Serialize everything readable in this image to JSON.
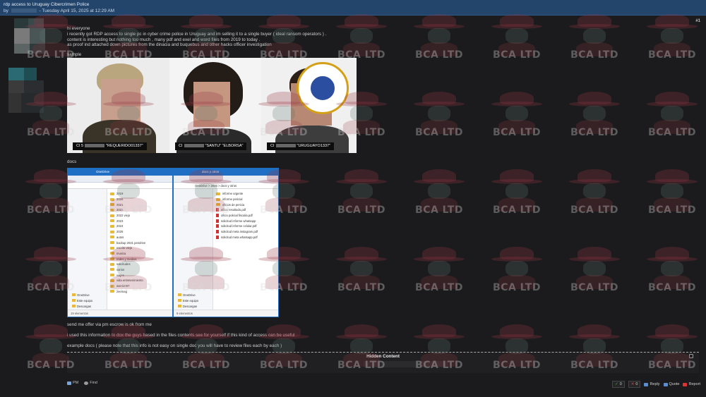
{
  "thread": {
    "title": "rdp access to Uruguay Cibercrimen Police",
    "by_label": "by",
    "date_text": "- Tuesday April 15, 2025 at 12:29 AM",
    "post_number": "#1"
  },
  "post": {
    "line1": "hi everyone",
    "line2": "i recently got RDP access to single pc in cyber crime police in Uruguay and im selling it to a single buyer ( ideal ransom operators ) .",
    "line3": "content is interesting but nothing too much , many pdf and exel and word files from 2019 to today .",
    "line4": "as proof ind attached down pictures from the dinacia and buquebus and other hacks officer investigation",
    "sample_label": "sample",
    "docs_label": "docs",
    "line5": "send me offer via pm escrow is ok from me",
    "line6": "i used this information to dox the guys based in the files contents see for yourself if this kind of access can be useful",
    "line7": "example docs ( please note that this info is not easy on single doc you will have to review files each by each )"
  },
  "mugshots": [
    {
      "prefix": "CI 5",
      "alias": "\"REQUERIDO01337\""
    },
    {
      "prefix": "CI",
      "alias": "\"SANTU\" \"ELBORSA\""
    },
    {
      "prefix": "CI",
      "alias": "\"URUGUAYO1337\""
    }
  ],
  "explorer_left": {
    "title": "OneDrive",
    "tree": [
      "OneDrive",
      "Este equipo",
      "Descargas"
    ],
    "rows": [
      "2019",
      "2020",
      "2021",
      "2022",
      "2022 viejo",
      "2023",
      "2024",
      "2025",
      "autos",
      "backup 2021 pendrive",
      "escrito viejo",
      "musica",
      "redes y medios",
      "solicitudes",
      "varios",
      "viajes",
      "vida entretenimiento",
      "word2007",
      "zeemag"
    ],
    "status": "19 elementos"
  },
  "explorer_right": {
    "title": "docs y otros",
    "tree": [
      "OneDrive",
      "Este equipo",
      "Descargas"
    ],
    "path": "OneDrive > 2025 > docs y otros",
    "rows": [
      "informe urgente",
      "informe pericial",
      "oficios de pericia",
      "oficio resultado.pdf",
      "oficio policial fiscalia.pdf",
      "solicitud informe whatsapp",
      "solicitud informe celular.pdf",
      "solicitud meta instagram.pdf",
      "solicitud meta whatsapp.pdf"
    ],
    "status": "9 elementos"
  },
  "hidden": {
    "label": "Hidden Content"
  },
  "footer": {
    "pm": "PM",
    "find": "Find",
    "up_count": "0",
    "down_count": "0",
    "reply": "Reply",
    "quote": "Quote",
    "report": "Report"
  },
  "watermark": {
    "text": "BCA LTD"
  },
  "colors": {
    "header_bg": "#23446b",
    "page_bg": "#1b1b1d",
    "explorer_accent": "#1f6fc5"
  }
}
